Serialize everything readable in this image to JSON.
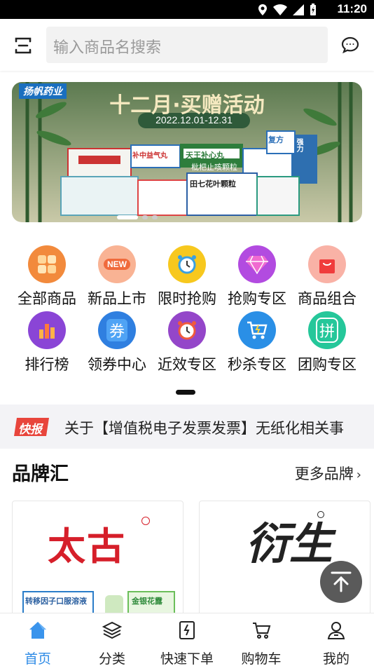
{
  "status_bar": {
    "time": "11:20"
  },
  "header": {
    "search_placeholder": "输入商品名搜索"
  },
  "banner": {
    "brand": "扬帆药业",
    "title": "十二月·买赠活动",
    "date_range": "2022.12.01-12.31",
    "box_labels": [
      "补中益气丸",
      "天王补心丸",
      "枇杷止咳颗粒",
      "田七花叶颗粒",
      "复方",
      "强力"
    ]
  },
  "categories": [
    {
      "label": "全部商品",
      "icon": "grid-icon",
      "color": "#f28a3c"
    },
    {
      "label": "新品上市",
      "icon": "new-icon",
      "color": "#f57d4f",
      "badge": "NEW"
    },
    {
      "label": "限时抢购",
      "icon": "alarm-clock-icon",
      "color": "#f5c518"
    },
    {
      "label": "抢购专区",
      "icon": "diamond-icon",
      "color": "#b24be0"
    },
    {
      "label": "商品组合",
      "icon": "shopping-bag-icon",
      "color": "#f45b4b"
    },
    {
      "label": "排行榜",
      "icon": "bar-chart-icon",
      "color": "#8a45d6"
    },
    {
      "label": "领券中心",
      "icon": "coupon-icon",
      "color": "#2f7fe0",
      "glyph": "券"
    },
    {
      "label": "近效专区",
      "icon": "clock-icon",
      "color": "#9446c9"
    },
    {
      "label": "秒杀专区",
      "icon": "cart-icon",
      "color": "#2a8fe6"
    },
    {
      "label": "团购专区",
      "icon": "group-buy-icon",
      "color": "#25c79a",
      "glyph": "拼"
    }
  ],
  "news": {
    "tag": "快报",
    "text": "关于【增值税电子发票发票】无纸化相关事"
  },
  "brands": {
    "title": "品牌汇",
    "more": "更多品牌",
    "cards": [
      {
        "logo": "太古",
        "product": "转移因子口服溶液",
        "product2": "金银花露"
      },
      {
        "logo": "衍生"
      }
    ]
  },
  "tabbar": [
    {
      "label": "首页",
      "icon": "home-icon",
      "active": true
    },
    {
      "label": "分类",
      "icon": "layers-icon"
    },
    {
      "label": "快速下单",
      "icon": "quick-order-icon"
    },
    {
      "label": "购物车",
      "icon": "cart-icon"
    },
    {
      "label": "我的",
      "icon": "user-icon"
    }
  ],
  "colors": {
    "accent": "#2e8be6",
    "news_tag": "#e8453c"
  }
}
